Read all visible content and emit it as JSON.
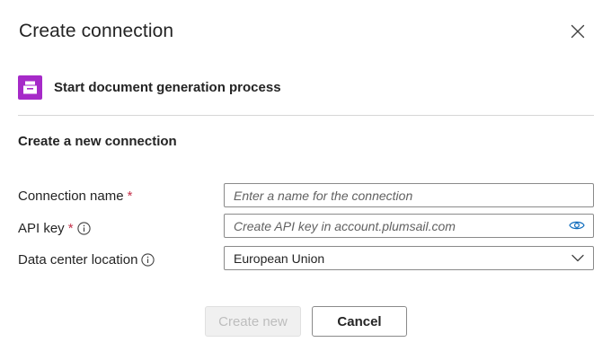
{
  "dialog": {
    "title": "Create connection"
  },
  "connector": {
    "name": "Start document generation process",
    "icon": "plumsail-documents-icon",
    "color": "#a62ac8"
  },
  "section": {
    "heading": "Create a new connection"
  },
  "fields": {
    "connection_name": {
      "label": "Connection name",
      "required_marker": "*",
      "placeholder": "Enter a name for the connection",
      "value": ""
    },
    "api_key": {
      "label": "API key",
      "required_marker": "*",
      "placeholder": "Create API key in account.plumsail.com",
      "value": "",
      "info_icon": "info-icon",
      "reveal_icon": "eye-icon"
    },
    "data_center": {
      "label": "Data center location",
      "info_icon": "info-icon",
      "selected": "European Union"
    }
  },
  "buttons": {
    "create_label": "Create new",
    "cancel_label": "Cancel"
  },
  "colors": {
    "required": "#c4314b",
    "accent": "#0f6cbd",
    "border": "#8a8a8a"
  }
}
